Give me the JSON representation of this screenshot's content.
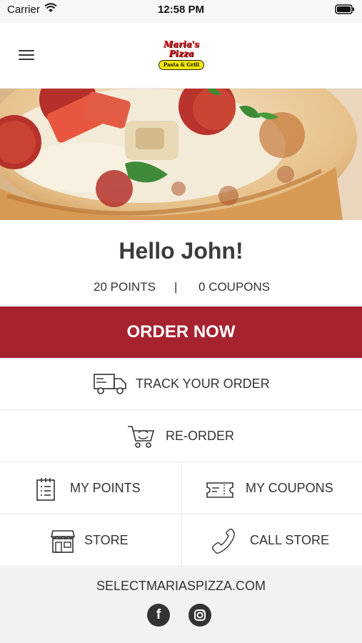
{
  "status_bar": {
    "carrier": "Carrier",
    "time": "12:58 PM"
  },
  "header": {
    "logo_line1": "Maria's",
    "logo_line2": "Pizza",
    "logo_badge": "Pasta & Grill"
  },
  "main": {
    "greeting": "Hello John!",
    "points": "20 POINTS",
    "separator": "|",
    "coupons": "0 COUPONS",
    "order_now": "ORDER NOW"
  },
  "menu": {
    "track_order": "TRACK YOUR ORDER",
    "reorder": "RE-ORDER",
    "my_points": "MY POINTS",
    "my_coupons": "MY COUPONS",
    "store": "STORE",
    "call_store": "CALL STORE"
  },
  "footer": {
    "website": "SELECTMARIASPIZZA.COM"
  },
  "icons": [
    "menu-icon",
    "truck-icon",
    "cart-icon",
    "points-card-icon",
    "coupon-icon",
    "store-icon",
    "phone-icon",
    "facebook-icon",
    "instagram-icon",
    "wifi-icon",
    "battery-icon"
  ],
  "colors": {
    "accent": "#a5222e",
    "footer_bg": "#f2f2f2",
    "text": "#333333"
  }
}
